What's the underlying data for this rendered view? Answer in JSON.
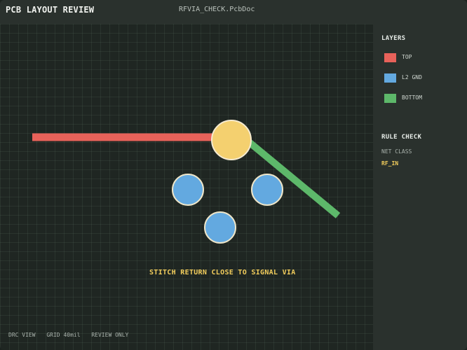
{
  "header": {
    "app_title": "PCB LAYOUT REVIEW",
    "document_name": "RFVIA_CHECK.PcbDoc"
  },
  "canvas": {
    "annotation": "STITCH RETURN CLOSE TO SIGNAL VIA",
    "signal_via": {
      "color": "#f4d06f"
    },
    "stitch_vias": {
      "color": "#63a9e0",
      "count": 3
    },
    "traces": [
      {
        "layer": "TOP",
        "color": "#e8625a"
      },
      {
        "layer": "BOTTOM",
        "color": "#5db86a"
      }
    ]
  },
  "status": {
    "mode": "DRC VIEW",
    "grid": "GRID 40mil",
    "access": "REVIEW ONLY"
  },
  "panel": {
    "layers_heading": "LAYERS",
    "layers": [
      {
        "label": "TOP",
        "color": "#e8625a"
      },
      {
        "label": "L2 GND",
        "color": "#63a9e0"
      },
      {
        "label": "BOTTOM",
        "color": "#5db86a"
      }
    ],
    "rule_heading": "RULE CHECK",
    "net_class_label": "NET CLASS",
    "net_class_value": "RF_IN"
  }
}
